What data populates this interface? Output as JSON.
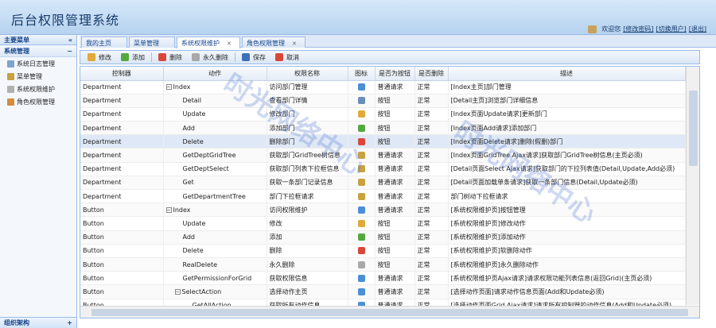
{
  "app": {
    "title": "后台权限管理系统"
  },
  "user": {
    "welcome": "欢迎您",
    "links": [
      "[修改密码]",
      "[切换用户]",
      "[退出]"
    ]
  },
  "sidebar": {
    "header": "主要菜单",
    "collapse": "«",
    "section": "系统管理",
    "section_toggle": "−",
    "items": [
      {
        "label": "系统日志管理",
        "icon": "log-icon",
        "color": "#7fa3cf"
      },
      {
        "label": "菜单管理",
        "icon": "menu-icon",
        "color": "#c9a23f"
      },
      {
        "label": "系统权限维护",
        "icon": "key-icon",
        "color": "#b0b0b0"
      },
      {
        "label": "角色权限管理",
        "icon": "role-icon",
        "color": "#d58b3c"
      }
    ],
    "footer": "组织架构",
    "footer_toggle": "+"
  },
  "tabs": [
    {
      "label": "我的主页"
    },
    {
      "label": "菜单管理"
    },
    {
      "label": "系统权限维护"
    },
    {
      "label": "角色权限管理"
    }
  ],
  "toolbar": {
    "buttons": [
      {
        "label": "修改",
        "icon": "edit-icon",
        "color": "#e0a93a"
      },
      {
        "label": "添加",
        "icon": "add-icon",
        "color": "#53a93f"
      },
      {
        "label": "删除",
        "icon": "delete-icon",
        "color": "#d9473a"
      },
      {
        "label": "永久删除",
        "icon": "permanent-delete-icon",
        "color": "#a9a9a9"
      },
      {
        "label": "保存",
        "icon": "save-icon",
        "color": "#3f6fb8"
      },
      {
        "label": "取消",
        "icon": "cancel-icon",
        "color": "#d9473a"
      }
    ]
  },
  "grid": {
    "columns": [
      "控制器",
      "动作",
      "权限名称",
      "图标",
      "是否为按钮",
      "是否删除",
      "描述"
    ],
    "rows": [
      {
        "c": "Department",
        "a": "Index",
        "n": "访问部门管理",
        "i": "#4a8fd8",
        "b": "普通请求",
        "d": "正常",
        "desc": "[Index主页]部门管理",
        "lvl": 0,
        "exp": "−"
      },
      {
        "c": "Department",
        "a": "Detail",
        "n": "查看部门详情",
        "i": "#6b8fb8",
        "b": "按钮",
        "d": "正常",
        "desc": "[Detail主页]浏览部门详细信息",
        "lvl": 1
      },
      {
        "c": "Department",
        "a": "Update",
        "n": "修改部门",
        "i": "#e0a93a",
        "b": "按钮",
        "d": "正常",
        "desc": "[Index页面Update请求]更新部门",
        "lvl": 1
      },
      {
        "c": "Department",
        "a": "Add",
        "n": "添加部门",
        "i": "#53a93f",
        "b": "按钮",
        "d": "正常",
        "desc": "[Index页面Add请求]添加部门",
        "lvl": 1
      },
      {
        "c": "Department",
        "a": "Delete",
        "n": "删除部门",
        "i": "#d9473a",
        "b": "按钮",
        "d": "正常",
        "desc": "[Index页面Delete请求]删除(假删)部门",
        "lvl": 1
      },
      {
        "c": "Department",
        "a": "GetDeptGridTree",
        "n": "获取部门GridTree树信息",
        "i": "#c9a23f",
        "b": "普通请求",
        "d": "正常",
        "desc": "[Index页面GridTree Ajax请求]获取部门GridTree树信息(主页必须)",
        "lvl": 1
      },
      {
        "c": "Department",
        "a": "GetDeptSelect",
        "n": "获取部门列表下拉框信息",
        "i": "#c9a23f",
        "b": "普通请求",
        "d": "正常",
        "desc": "[Detail页面Select Ajax请求]获取部门的下拉列表值(Detail,Update,Add必须)",
        "lvl": 1
      },
      {
        "c": "Department",
        "a": "Get",
        "n": "获取一条部门记录信息",
        "i": "#c9a23f",
        "b": "普通请求",
        "d": "正常",
        "desc": "[Detail页面加载单条请求]获取一条部门信息(Detail,Update必须)",
        "lvl": 1
      },
      {
        "c": "Department",
        "a": "GetDepartmentTree",
        "n": "部门下拉框请求",
        "i": "#c9a23f",
        "b": "普通请求",
        "d": "正常",
        "desc": "部门树动下拉框请求",
        "lvl": 1
      },
      {
        "c": "Button",
        "a": "Index",
        "n": "访问权限维护",
        "i": "#4a8fd8",
        "b": "普通请求",
        "d": "正常",
        "desc": "[系统权限维护页]按钮管理",
        "lvl": 0,
        "exp": "−"
      },
      {
        "c": "Button",
        "a": "Update",
        "n": "修改",
        "i": "#e0a93a",
        "b": "按钮",
        "d": "正常",
        "desc": "[系统权限维护页]修改动作",
        "lvl": 1
      },
      {
        "c": "Button",
        "a": "Add",
        "n": "添加",
        "i": "#53a93f",
        "b": "按钮",
        "d": "正常",
        "desc": "[系统权限维护页]添加动作",
        "lvl": 1
      },
      {
        "c": "Button",
        "a": "Delete",
        "n": "删除",
        "i": "#d9473a",
        "b": "按钮",
        "d": "正常",
        "desc": "[系统权限维护页]软删除动作",
        "lvl": 1
      },
      {
        "c": "Button",
        "a": "RealDelete",
        "n": "永久删除",
        "i": "#a9a9a9",
        "b": "按钮",
        "d": "正常",
        "desc": "[系统权限维护页]永久删除动作",
        "lvl": 1
      },
      {
        "c": "Button",
        "a": "GetPermissionForGrid",
        "n": "获取权限信息",
        "i": "#4a8fd8",
        "b": "普通请求",
        "d": "正常",
        "desc": "[系统权限维护页Ajax请求]请求权限功能列表信息(返回Grid)(主页必须)",
        "lvl": 1
      },
      {
        "c": "Button",
        "a": "SelectAction",
        "n": "选择动作主页",
        "i": "#4a8fd8",
        "b": "普通请求",
        "d": "正常",
        "desc": "[选择动作页面]请求动作信息页面(Add和Update必须)",
        "lvl": 1,
        "exp": "−"
      },
      {
        "c": "Button",
        "a": "GetAllAction",
        "n": "获取所有动作信息",
        "i": "#4a8fd8",
        "b": "普通请求",
        "d": "正常",
        "desc": "[选择动作页面Grid Ajax请求]请求所有控制器的动作信息(Add和Update必须)",
        "lvl": 2
      }
    ]
  },
  "watermark": "时光网络中心"
}
